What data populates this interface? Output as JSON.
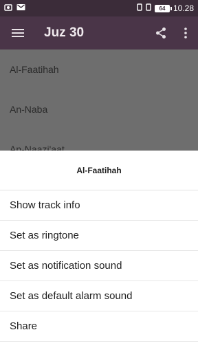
{
  "status_bar": {
    "time": "10.28",
    "battery": "64"
  },
  "toolbar": {
    "title": "Juz 30"
  },
  "list": {
    "items": [
      "Al-Faatihah",
      "An-Naba",
      "An-Naazi'aat"
    ]
  },
  "sheet": {
    "title": "Al-Faatihah",
    "options": [
      "Show track info",
      "Set as ringtone",
      "Set as notification sound",
      "Set as default alarm sound",
      "Share"
    ]
  },
  "icons": {
    "menu": "menu-icon",
    "share": "share-icon",
    "overflow": "more-vert-icon"
  },
  "colors": {
    "toolbar": "#4a3548",
    "status_bar": "#3b2c39",
    "scrim_list": "#6e6e6e"
  }
}
